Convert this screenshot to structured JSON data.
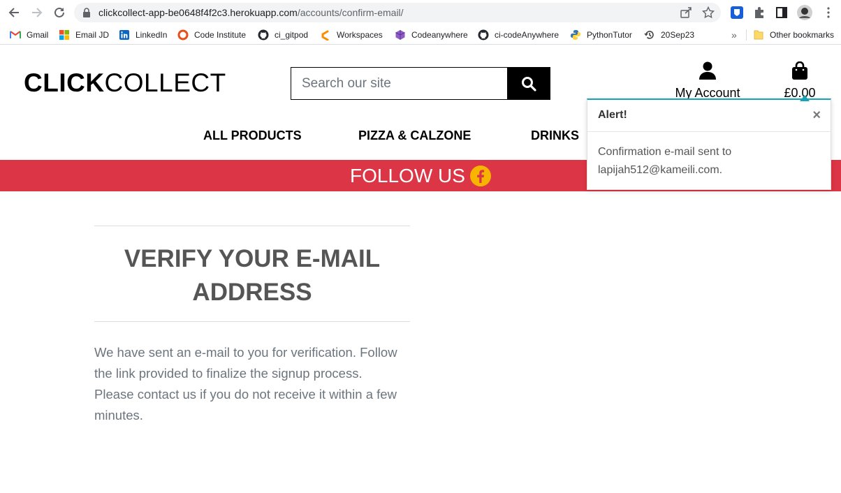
{
  "browser": {
    "url_host": "clickcollect-app-be0648f4f2c3.herokuapp.com",
    "url_path": "/accounts/confirm-email/",
    "bookmarks": [
      {
        "label": "Gmail",
        "icon": "gmail-icon"
      },
      {
        "label": "Email JD",
        "icon": "microsoft-icon"
      },
      {
        "label": "LinkedIn",
        "icon": "linkedin-icon"
      },
      {
        "label": "Code Institute",
        "icon": "code-institute-icon"
      },
      {
        "label": "ci_gitpod",
        "icon": "github-icon"
      },
      {
        "label": "Workspaces",
        "icon": "gitpod-icon"
      },
      {
        "label": "Codeanywhere",
        "icon": "codeanywhere-icon"
      },
      {
        "label": "ci-codeAnywhere",
        "icon": "github-icon"
      },
      {
        "label": "PythonTutor",
        "icon": "python-icon"
      },
      {
        "label": "20Sep23",
        "icon": "history-icon"
      }
    ],
    "overflow": "»",
    "other_bookmarks": "Other bookmarks"
  },
  "header": {
    "logo_bold": "CLICK",
    "logo_regular": "COLLECT",
    "search_placeholder": "Search our site",
    "account_label": "My Account",
    "bag_total": "£0.00"
  },
  "nav": {
    "items": [
      "ALL PRODUCTS",
      "PIZZA & CALZONE",
      "DRINKS"
    ]
  },
  "banner": {
    "text": "FOLLOW US"
  },
  "content": {
    "title": "VERIFY YOUR E-MAIL ADDRESS",
    "body": "We have sent an e-mail to you for verification. Follow the link provided to finalize the signup process. Please contact us if you do not receive it within a few minutes."
  },
  "toast": {
    "title": "Alert!",
    "close": "×",
    "message": "Confirmation e-mail sent to lapijah512@kameili.com."
  },
  "colors": {
    "banner": "#dc3545",
    "toast_accent": "#17a2b8",
    "facebook_badge": "#f7b500"
  }
}
